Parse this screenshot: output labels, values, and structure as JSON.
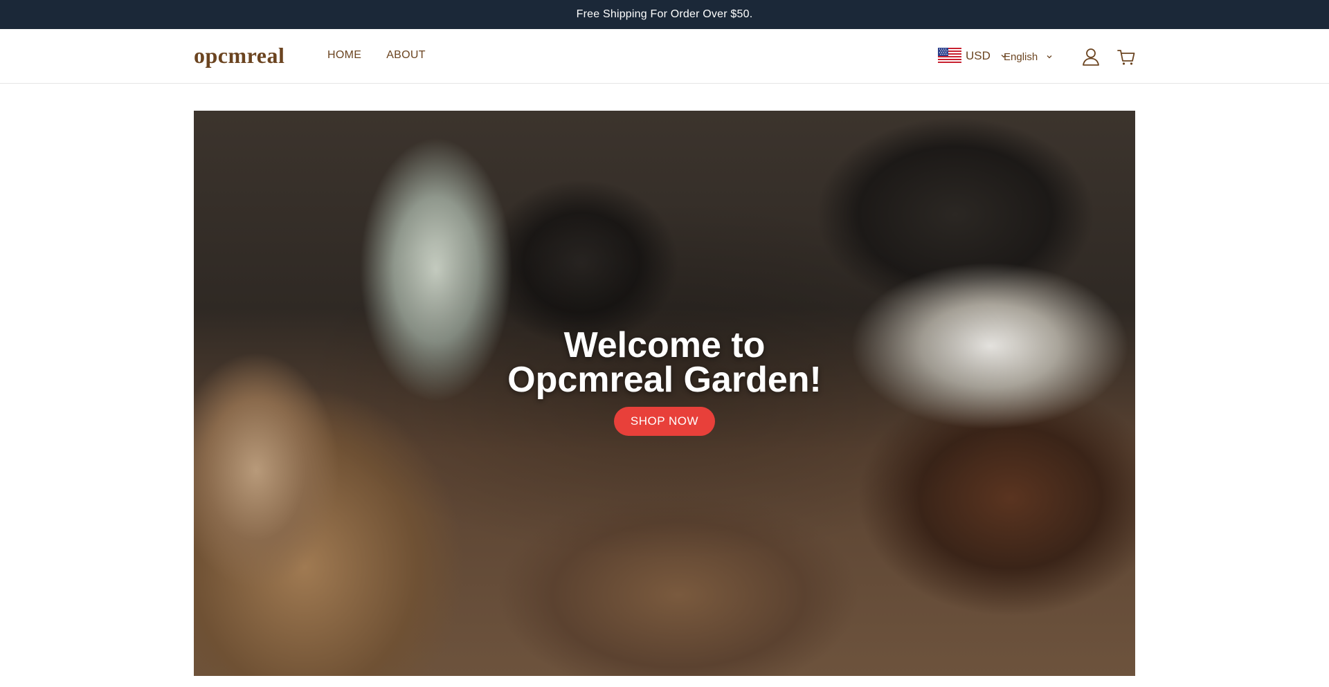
{
  "announcement": {
    "text": "Free Shipping For Order Over $50."
  },
  "header": {
    "logo": "opcmreal",
    "nav": [
      {
        "label": "HOME"
      },
      {
        "label": "ABOUT"
      }
    ],
    "currency": {
      "value": "USD",
      "flag_icon": "us-flag-icon"
    },
    "language": {
      "value": "English"
    },
    "icons": [
      "account-icon",
      "cart-icon"
    ]
  },
  "hero": {
    "title_line1": "Welcome to",
    "title_line2": "Opcmreal Garden!",
    "button_label": "SHOP NOW",
    "button_color": "#e8403a"
  },
  "colors": {
    "announcement_bg": "#1b2838",
    "brand": "#6b4420"
  }
}
